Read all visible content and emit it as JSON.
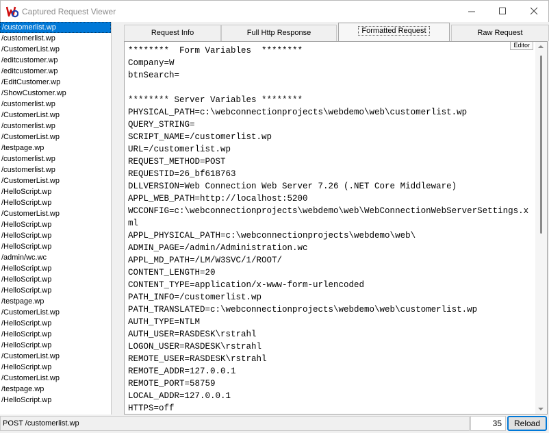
{
  "window": {
    "title": "Captured Request Viewer",
    "icon": "wc-app-icon",
    "controls": [
      "minimize-icon",
      "maximize-icon",
      "close-icon"
    ]
  },
  "requests": [
    "/customerlist.wp",
    "/customerlist.wp",
    "/CustomerList.wp",
    "/editcustomer.wp",
    "/editcustomer.wp",
    "/EditCustomer.wp",
    "/ShowCustomer.wp",
    "/customerlist.wp",
    "/CustomerList.wp",
    "/customerlist.wp",
    "/CustomerList.wp",
    "/testpage.wp",
    "/customerlist.wp",
    "/customerlist.wp",
    "/CustomerList.wp",
    "/HelloScript.wp",
    "/HelloScript.wp",
    "/CustomerList.wp",
    "/HelloScript.wp",
    "/HelloScript.wp",
    "/HelloScript.wp",
    "/admin/wc.wc",
    "/HelloScript.wp",
    "/HelloScript.wp",
    "/HelloScript.wp",
    "/testpage.wp",
    "/CustomerList.wp",
    "/HelloScript.wp",
    "/HelloScript.wp",
    "/HelloScript.wp",
    "/CustomerList.wp",
    "/HelloScript.wp",
    "/CustomerList.wp",
    "/testpage.wp",
    "/HelloScript.wp"
  ],
  "selected_index": 0,
  "tabs": {
    "request_info": "Request Info",
    "full_http_response": "Full Http Response",
    "formatted_request": "Formatted Request",
    "raw_request": "Raw Request",
    "active": "formatted_request"
  },
  "editor_button": "Editor",
  "formatted_request": "********  Form Variables  ********\nCompany=W\nbtnSearch=\n\n******** Server Variables ********\nPHYSICAL_PATH=c:\\webconnectionprojects\\webdemo\\web\\customerlist.wp\nQUERY_STRING=\nSCRIPT_NAME=/customerlist.wp\nURL=/customerlist.wp\nREQUEST_METHOD=POST\nREQUESTID=26_bf618763\nDLLVERSION=Web Connection Web Server 7.26 (.NET Core Middleware)\nAPPL_WEB_PATH=http://localhost:5200\nWCCONFIG=c:\\webconnectionprojects\\webdemo\\web\\WebConnectionWebServerSettings.xml\nAPPL_PHYSICAL_PATH=c:\\webconnectionprojects\\webdemo\\web\\\nADMIN_PAGE=/admin/Administration.wc\nAPPL_MD_PATH=/LM/W3SVC/1/ROOT/\nCONTENT_LENGTH=20\nCONTENT_TYPE=application/x-www-form-urlencoded\nPATH_INFO=/customerlist.wp\nPATH_TRANSLATED=c:\\webconnectionprojects\\webdemo\\web\\customerlist.wp\nAUTH_TYPE=NTLM\nAUTH_USER=RASDESK\\rstrahl\nLOGON_USER=RASDESK\\rstrahl\nREMOTE_USER=RASDESK\\rstrahl\nREMOTE_ADDR=127.0.0.1\nREMOTE_PORT=58759\nLOCAL_ADDR=127.0.0.1\nHTTPS=off",
  "status": {
    "text": "POST /customerlist.wp",
    "count": "35",
    "reload_label": "Reload"
  },
  "colors": {
    "selection": "#0078d7",
    "reload_border": "#0078d7",
    "title_text": "#8a8a8a"
  }
}
